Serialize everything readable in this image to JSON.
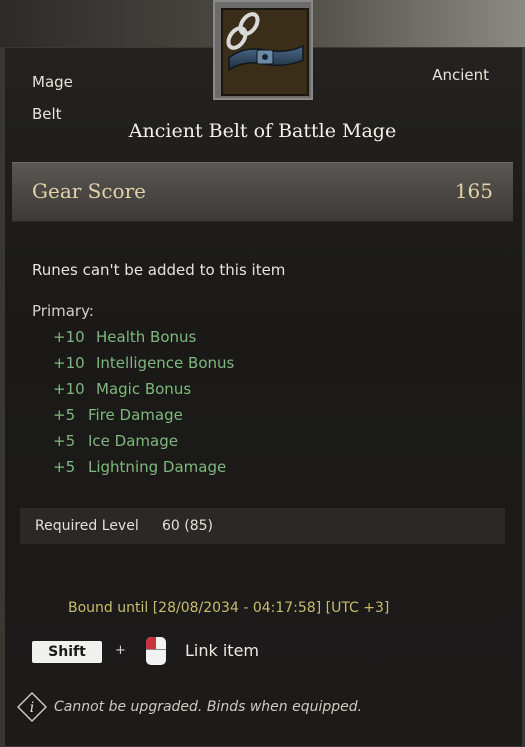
{
  "item": {
    "class": "Mage",
    "type": "Belt",
    "rarity": "Ancient",
    "name": "Ancient Belt of Battle Mage"
  },
  "gear_score": {
    "label": "Gear Score",
    "value": "165"
  },
  "runes_note": "Runes can't be added to this item",
  "primary": {
    "header": "Primary:",
    "stats": [
      {
        "value": "+10",
        "name": "Health Bonus"
      },
      {
        "value": "+10",
        "name": "Intelligence Bonus"
      },
      {
        "value": "+10",
        "name": "Magic Bonus"
      },
      {
        "value": "+5",
        "name": "Fire Damage"
      },
      {
        "value": "+5",
        "name": "Ice Damage"
      },
      {
        "value": "+5",
        "name": "Lightning Damage"
      }
    ]
  },
  "required_level": {
    "label": "Required Level",
    "value": "60 (85)"
  },
  "bound_until": "Bound until [28/08/2034 - 04:17:58] [UTC +3]",
  "hint": {
    "key": "Shift",
    "plus": "+",
    "action": "Link item"
  },
  "footer": "Cannot be upgraded. Binds when equipped.",
  "colors": {
    "stat_green": "#7fb87e",
    "gear_gold": "#e3d2a7",
    "bound_yellow": "#c9bc6d"
  },
  "icons": {
    "item": "belt-icon",
    "chain": "chain-link-icon",
    "mouse": "mouse-left-click-icon",
    "info": "info-icon"
  }
}
